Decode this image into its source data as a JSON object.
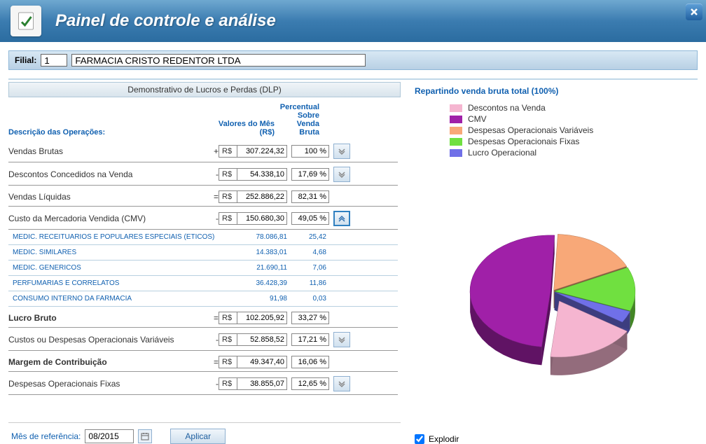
{
  "header": {
    "title": "Painel de controle e análise"
  },
  "filial": {
    "label": "Filial:",
    "number": "1",
    "name": "FARMACIA CRISTO REDENTOR LTDA"
  },
  "section_title": "Demonstrativo de Lucros e Perdas (DLP)",
  "columns": {
    "desc": "Descrição das Operações:",
    "val": "Valores do Mês (R$)",
    "pct_l1": "Percentual",
    "pct_l2": "Sobre",
    "pct_l3": "Venda",
    "pct_l4": "Bruta"
  },
  "rows": [
    {
      "desc": "Vendas Brutas",
      "sign": "+",
      "curr": "R$",
      "val": "307.224,32",
      "pct": "100 %",
      "expand": "down",
      "bold": false
    },
    {
      "desc": "Descontos Concedidos na Venda",
      "sign": "-",
      "curr": "R$",
      "val": "54.338,10",
      "pct": "17,69 %",
      "expand": "down",
      "bold": false
    },
    {
      "desc": "Vendas Líquidas",
      "sign": "=",
      "curr": "R$",
      "val": "252.886,22",
      "pct": "82,31 %",
      "expand": null,
      "bold": false
    },
    {
      "desc": "Custo da Mercadoria Vendida (CMV)",
      "sign": "-",
      "curr": "R$",
      "val": "150.680,30",
      "pct": "49,05 %",
      "expand": "up",
      "bold": false
    }
  ],
  "subrows": [
    {
      "desc": "MEDIC. RECEITUARIOS E POPULARES ESPECIAIS (ETICOS)",
      "val": "78.086,81",
      "pct": "25,42"
    },
    {
      "desc": "MEDIC. SIMILARES",
      "val": "14.383,01",
      "pct": "4,68"
    },
    {
      "desc": "MEDIC. GENERICOS",
      "val": "21.690,11",
      "pct": "7,06"
    },
    {
      "desc": "PERFUMARIAS E CORRELATOS",
      "val": "36.428,39",
      "pct": "11,86"
    },
    {
      "desc": "CONSUMO INTERNO DA FARMACIA",
      "val": "91,98",
      "pct": "0,03"
    }
  ],
  "rows2": [
    {
      "desc": "Lucro Bruto",
      "sign": "=",
      "curr": "R$",
      "val": "102.205,92",
      "pct": "33,27 %",
      "expand": null,
      "bold": true
    },
    {
      "desc": "Custos ou Despesas Operacionais Variáveis",
      "sign": "-",
      "curr": "R$",
      "val": "52.858,52",
      "pct": "17,21 %",
      "expand": "down",
      "bold": false
    },
    {
      "desc": "Margem de Contribuição",
      "sign": "=",
      "curr": "R$",
      "val": "49.347,40",
      "pct": "16,06 %",
      "expand": null,
      "bold": true
    },
    {
      "desc": "Despesas Operacionais Fixas",
      "sign": "-",
      "curr": "R$",
      "val": "38.855,07",
      "pct": "12,65 %",
      "expand": "down",
      "bold": false
    }
  ],
  "ref": {
    "label": "Mês de referência:",
    "value": "08/2015",
    "apply": "Aplicar"
  },
  "chart_data": {
    "type": "pie",
    "title": "Repartindo venda bruta total (100%)",
    "series": [
      {
        "name": "Descontos na Venda",
        "value": 17.69,
        "color": "#F5B5D0"
      },
      {
        "name": "CMV",
        "value": 49.05,
        "color": "#A020A8"
      },
      {
        "name": "Despesas Operacionais Variáveis",
        "value": 17.21,
        "color": "#F8A878"
      },
      {
        "name": "Despesas Operacionais Fixas",
        "value": 12.65,
        "color": "#70E040"
      },
      {
        "name": "Lucro Operacional",
        "value": 3.4,
        "color": "#7070E8"
      }
    ]
  },
  "explode": {
    "label": "Explodir",
    "checked": true
  }
}
